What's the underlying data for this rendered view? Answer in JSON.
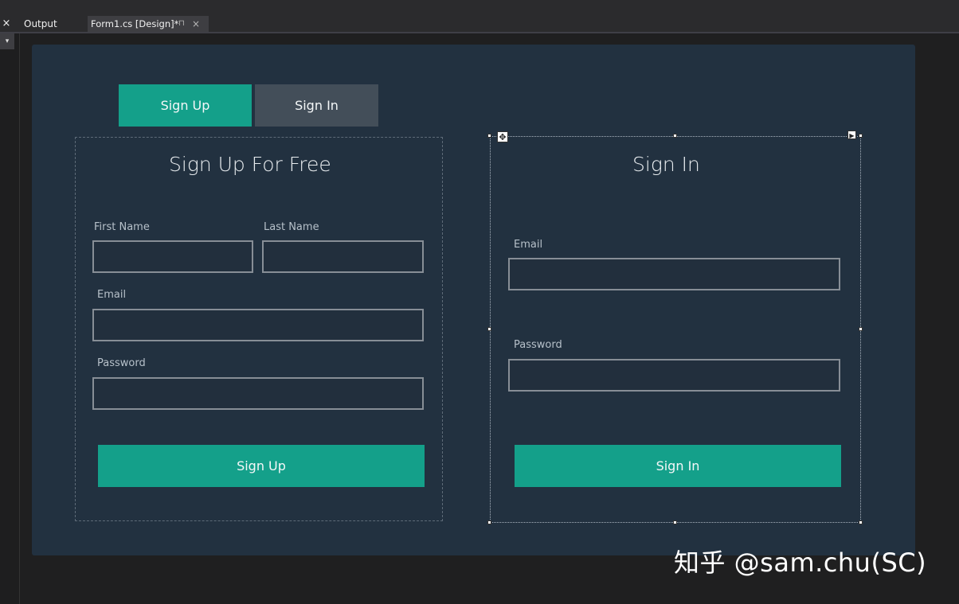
{
  "ide": {
    "tabs": [
      {
        "label": "Output"
      },
      {
        "label": "Form1.cs [Design]*"
      }
    ],
    "close_symbol": "×",
    "pin_symbol": "⊓"
  },
  "form": {
    "tabs": {
      "sign_up": "Sign Up",
      "sign_in": "Sign In"
    },
    "sign_up_panel": {
      "heading": "Sign Up For Free",
      "first_name_label": "First Name",
      "last_name_label": "Last  Name",
      "email_label": "Email",
      "password_label": "Password",
      "first_name_value": "",
      "last_name_value": "",
      "email_value": "",
      "password_value": "",
      "submit_label": "Sign Up"
    },
    "sign_in_panel": {
      "heading": "Sign In",
      "email_label": "Email",
      "password_label": "Password",
      "email_value": "",
      "password_value": "",
      "submit_label": "Sign In"
    }
  },
  "colors": {
    "accent": "#14a08a",
    "form_background": "#223140",
    "inactive_tab": "#434e59"
  },
  "watermark": "知乎 @sam.chu(SC)"
}
